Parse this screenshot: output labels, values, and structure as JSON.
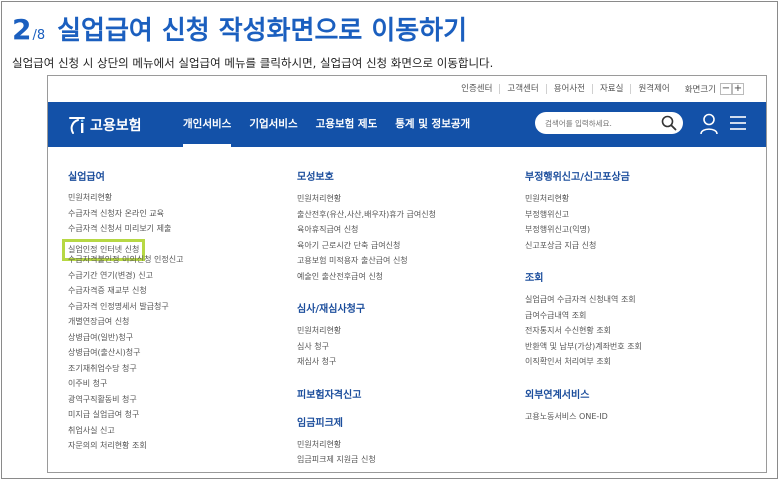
{
  "header": {
    "step_number": "2",
    "step_total": "/8",
    "title": "실업급여 신청 작성화면으로 이동하기",
    "description": "실업급여 신청 시 상단의 메뉴에서 실업급여 메뉴를 클릭하시면, 실업급여 신청 화면으로 이동합니다."
  },
  "utility": {
    "items": [
      "인증센터",
      "고객센터",
      "용어사전",
      "자료실",
      "원격제어"
    ],
    "zoom_label": "화면크기",
    "zoom_minus": "−",
    "zoom_plus": "+"
  },
  "nav": {
    "logo_text": "고용보험",
    "menu": [
      "개인서비스",
      "기업서비스",
      "고용보험 제도",
      "통계 및 정보공개"
    ],
    "active_index": 0,
    "search_placeholder": "검색어를 입력하세요."
  },
  "mega_menu": {
    "col1": {
      "title": "실업급여",
      "items": [
        "민원처리현황",
        "수급자격 신청자 온라인 교육",
        "수급자격 신청서 미리보기 제출",
        "실업인정 인터넷 신청",
        "수급자격불인정 이의신청 인정신고",
        "수급기간 연기(변경) 신고",
        "수급자격증 재교부 신청",
        "수급자격 인정명세서 발급청구",
        "개별연장급여 신청",
        "상병급여(일반)청구",
        "상병급여(출산시)청구",
        "조기재취업수당 청구",
        "이주비 청구",
        "광역구직활동비 청구",
        "미지급 실업급여 청구",
        "취업사실 신고",
        "자문의의 처리현황 조회"
      ],
      "highlighted_index": 3
    },
    "col2": [
      {
        "title": "모성보호",
        "items": [
          "민원처리현황",
          "출산전후(유산,사산,배우자)휴가 급여신청",
          "육아휴직급여 신청",
          "육아기 근로시간 단축 급여신청",
          "고용보험 미적용자 출산급여 신청",
          "예술인 출산전후급여 신청"
        ]
      },
      {
        "title": "심사/재심사청구",
        "items": [
          "민원처리현황",
          "심사 청구",
          "재심사 청구"
        ]
      },
      {
        "title": "피보험자격신고",
        "items": []
      },
      {
        "title": "임금피크제",
        "items": [
          "민원처리현황",
          "임금피크제 지원금 신청"
        ]
      }
    ],
    "col3": [
      {
        "title": "부정행위신고/신고포상금",
        "items": [
          "민원처리현황",
          "부정행위신고",
          "부정행위신고(익명)",
          "신고포상금 지급 신청"
        ]
      },
      {
        "title": "조회",
        "items": [
          "실업급여 수급자격 신청내역 조회",
          "급여수급내역 조회",
          "전자통지서 수신현황 조회",
          "반환액 및 납부(가상)계좌번호 조회",
          "이직확인서 처리여부 조회"
        ]
      },
      {
        "title": "외부연계서비스",
        "items": [
          "고용노동서비스 ONE-ID"
        ]
      }
    ]
  },
  "colors": {
    "brand_blue": "#1351a8",
    "title_blue": "#1b5fbf",
    "highlight_green": "#b7d844"
  }
}
